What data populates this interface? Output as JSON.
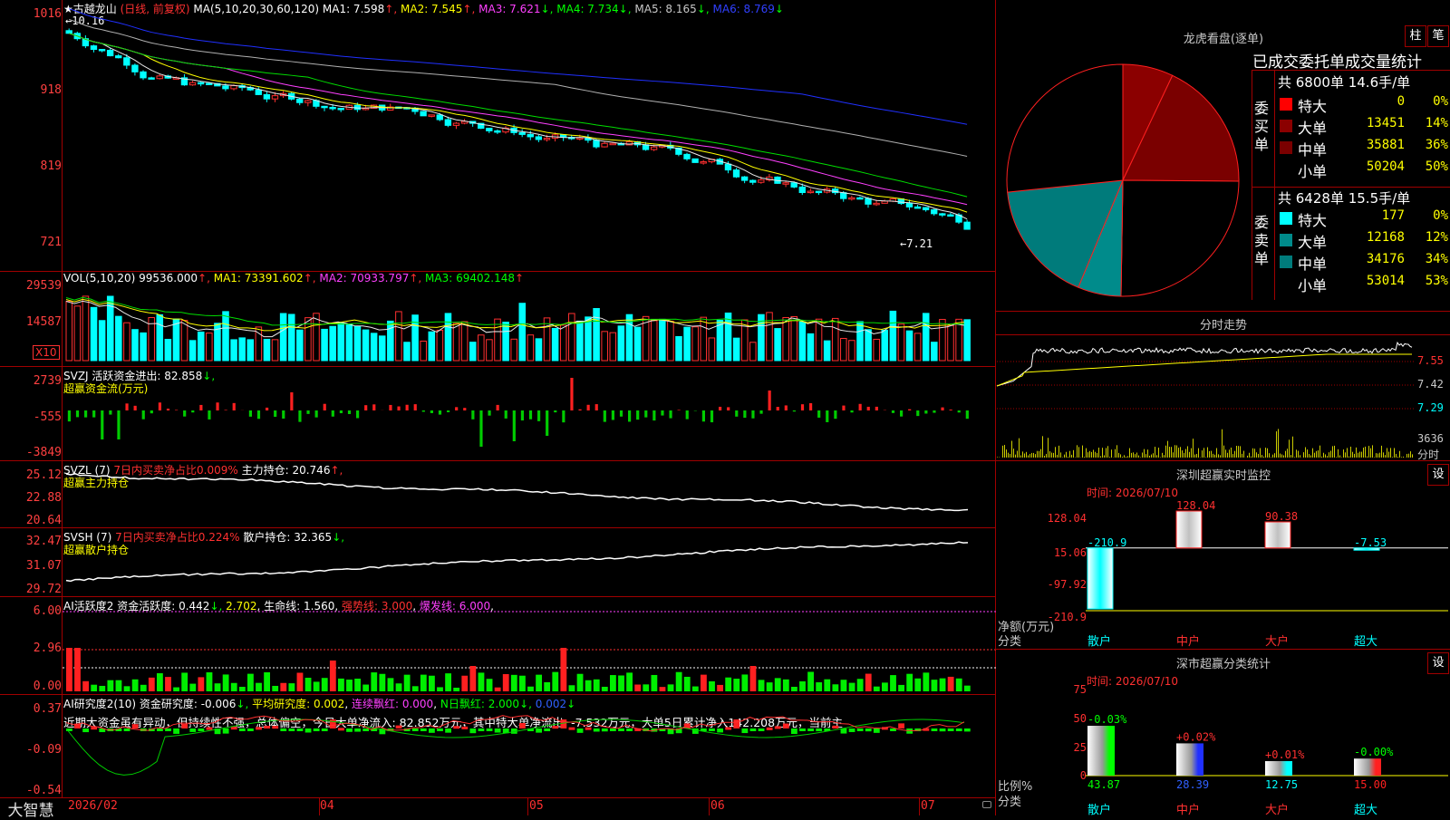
{
  "main_chart": {
    "stock_name": "★古越龙山",
    "mode": "(日线, 前复权)",
    "ma_label": "MA(5,10,20,30,60,120)",
    "ma1": "MA1: 7.598",
    "ma2": "MA2: 7.545",
    "ma3": "MA3: 7.621",
    "ma4": "MA4: 7.734",
    "ma5": "MA5: 8.165",
    "ma6": "MA6: 8.769",
    "high_label": "←10.16",
    "low_label": "←7.21",
    "y_ticks": [
      "1016",
      "918",
      "819",
      "721"
    ]
  },
  "volume_panel": {
    "label": "VOL(5,10,20)",
    "value": "99536.000",
    "ma1": "MA1: 73391.602",
    "ma2": "MA2: 70933.797",
    "ma3": "MA3: 69402.148",
    "y_ticks": [
      "29539",
      "14587"
    ],
    "unit": "X10"
  },
  "svzj_panel": {
    "label": "SVZJ",
    "line1": "活跃资金进出: 82.858",
    "line2": "超赢资金流(万元)",
    "y_ticks": [
      "2739",
      "-555",
      "-3849"
    ]
  },
  "svzl_panel": {
    "label": "SVZL (7)",
    "ratio": "7日内买卖净占比0.009%",
    "hold": "主力持仓: 20.746",
    "line2": "超赢主力持仓",
    "y_ticks": [
      "25.12",
      "22.88",
      "20.64"
    ]
  },
  "svsh_panel": {
    "label": "SVSH (7)",
    "ratio": "7日内买卖净占比0.224%",
    "hold": "散户持仓: 32.365",
    "line2": "超赢散户持仓",
    "y_ticks": [
      "32.47",
      "31.07",
      "29.72"
    ]
  },
  "ai_active_panel": {
    "label": "AI活跃度2",
    "activity": "资金活跃度: 0.442",
    "v2": "2.702",
    "life": "生命线: 1.560",
    "strong": "强势线: 3.000",
    "burst": "爆发线: 6.000",
    "y_ticks": [
      "6.00",
      "2.96",
      "0.00"
    ]
  },
  "ai_research_panel": {
    "label": "AI研究度2(10)",
    "research": "资金研究度: -0.006",
    "avg": "平均研究度: 0.002",
    "consecutive": "连续飘红: 0.000",
    "n_days": "N日飘红: 2.000",
    "v5": "0.002",
    "commentary": "近期大资金虽有异动，但持续性不强，总体偏空，今日大单净流入: 82.852万元，其中特大单净流出: -7.532万元，大单5日累计净入142.208万元，当前主",
    "y_ticks": [
      "0.37",
      "-0.09",
      "-0.54"
    ]
  },
  "date_axis": {
    "labels": [
      "2026/02",
      "04",
      "05",
      "06",
      "07"
    ]
  },
  "brand": "大智慧",
  "dragon_panel": {
    "title": "龙虎看盘(逐单)",
    "btn1": "柱",
    "btn2": "笔",
    "stats_title": "已成交委托单成交量统计",
    "buy_header": "共 6800单 14.6手/单",
    "buy_side_label": "委买单",
    "buy_rows": [
      {
        "name": "特大",
        "vol": "0",
        "pct": "0%",
        "color": "#ff0000"
      },
      {
        "name": "大单",
        "vol": "13451",
        "pct": "14%",
        "color": "#8b0000"
      },
      {
        "name": "中单",
        "vol": "35881",
        "pct": "36%",
        "color": "#7a0000"
      },
      {
        "name": "小单",
        "vol": "50204",
        "pct": "50%",
        "color": "#000000"
      }
    ],
    "sell_header": "共 6428单 15.5手/单",
    "sell_side_label": "委卖单",
    "sell_rows": [
      {
        "name": "特大",
        "vol": "177",
        "pct": "0%",
        "color": "#00ffff"
      },
      {
        "name": "大单",
        "vol": "12168",
        "pct": "12%",
        "color": "#008b8b"
      },
      {
        "name": "中单",
        "vol": "34176",
        "pct": "34%",
        "color": "#007b7b"
      },
      {
        "name": "小单",
        "vol": "53014",
        "pct": "53%",
        "color": "#000000"
      }
    ]
  },
  "intraday_panel": {
    "title": "分时走势",
    "y_ticks": [
      "7.55",
      "7.42",
      "7.29"
    ],
    "vol_tick": "3636",
    "vol_unit": "分时"
  },
  "sz_monitor_panel": {
    "title": "深圳超赢实时监控",
    "btn": "设",
    "time": "时间: 2026/07/10",
    "y_ticks": [
      "128.04",
      "15.06",
      "-97.92",
      "-210.9"
    ],
    "ylabel": "净额(万元)",
    "xlabel": "分类",
    "categories": [
      "散户",
      "中户",
      "大户",
      "超大"
    ],
    "values": [
      "-210.9",
      "128.04",
      "90.38",
      "-7.53"
    ]
  },
  "classify_panel": {
    "title": "深市超赢分类统计",
    "btn": "设",
    "time": "时间: 2026/07/10",
    "y_ticks": [
      "75",
      "50",
      "25",
      "0"
    ],
    "ylabel": "比例%",
    "xlabel": "分类",
    "categories": [
      "散户",
      "中户",
      "大户",
      "超大"
    ],
    "changes": [
      "-0.03%",
      "+0.02%",
      "+0.01%",
      "-0.00%"
    ],
    "values": [
      "43.87",
      "28.39",
      "12.75",
      "15.00"
    ]
  },
  "chart_data": [
    {
      "type": "pie",
      "title": "龙虎看盘(逐单)",
      "slices": [
        {
          "name": "委买 特大",
          "value": 0,
          "color": "#ff0000"
        },
        {
          "name": "委买 大单",
          "value": 14,
          "color": "#8b0000"
        },
        {
          "name": "委买 中单",
          "value": 36,
          "color": "#7a0000"
        },
        {
          "name": "委买 小单",
          "value": 50,
          "color": "#000000"
        },
        {
          "name": "委卖 特大",
          "value": 0,
          "color": "#00ffff"
        },
        {
          "name": "委卖 大单",
          "value": 12,
          "color": "#008b8b"
        },
        {
          "name": "委卖 中单",
          "value": 34,
          "color": "#007b7b"
        },
        {
          "name": "委卖 小单",
          "value": 53,
          "color": "#000000"
        }
      ]
    },
    {
      "type": "bar",
      "title": "深圳超赢实时监控",
      "categories": [
        "散户",
        "中户",
        "大户",
        "超大"
      ],
      "values": [
        -210.9,
        128.04,
        90.38,
        -7.53
      ],
      "ylabel": "净额(万元)",
      "xlabel": "分类",
      "ylim": [
        -210.9,
        128.04
      ]
    },
    {
      "type": "bar",
      "title": "深市超赢分类统计",
      "categories": [
        "散户",
        "中户",
        "大户",
        "超大"
      ],
      "values": [
        43.87,
        28.39,
        12.75,
        15.0
      ],
      "ylabel": "比例%",
      "xlabel": "分类",
      "ylim": [
        0,
        75
      ]
    }
  ]
}
